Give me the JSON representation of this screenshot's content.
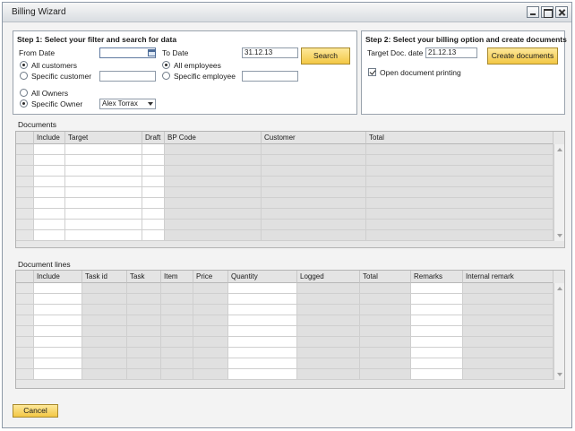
{
  "window": {
    "title": "Billing Wizard"
  },
  "step1": {
    "heading": "Step 1: Select your filter and search for data",
    "from_date_label": "From Date",
    "from_date_value": "",
    "to_date_label": "To Date",
    "to_date_value": "31.12.13",
    "search_label": "Search",
    "all_customers_label": "All customers",
    "specific_customer_label": "Specific customer",
    "all_employees_label": "All employees",
    "specific_employee_label": "Specific employee",
    "all_owners_label": "All Owners",
    "specific_owner_label": "Specific Owner",
    "owner_value": "Alex Torrax"
  },
  "step2": {
    "heading": "Step 2: Select your billing option and create documents",
    "target_date_label": "Target Doc. date",
    "target_date_value": "21.12.13",
    "create_label": "Create documents",
    "open_printing_label": "Open document printing"
  },
  "documents": {
    "label": "Documents",
    "columns": [
      "Include",
      "Target",
      "Draft",
      "BP Code",
      "Customer",
      "Total"
    ]
  },
  "lines": {
    "label": "Document lines",
    "columns": [
      "Include",
      "Task id",
      "Task",
      "Item",
      "Price",
      "Quantity",
      "Logged",
      "Total",
      "Remarks",
      "Internal remark"
    ]
  },
  "footer": {
    "cancel_label": "Cancel"
  }
}
